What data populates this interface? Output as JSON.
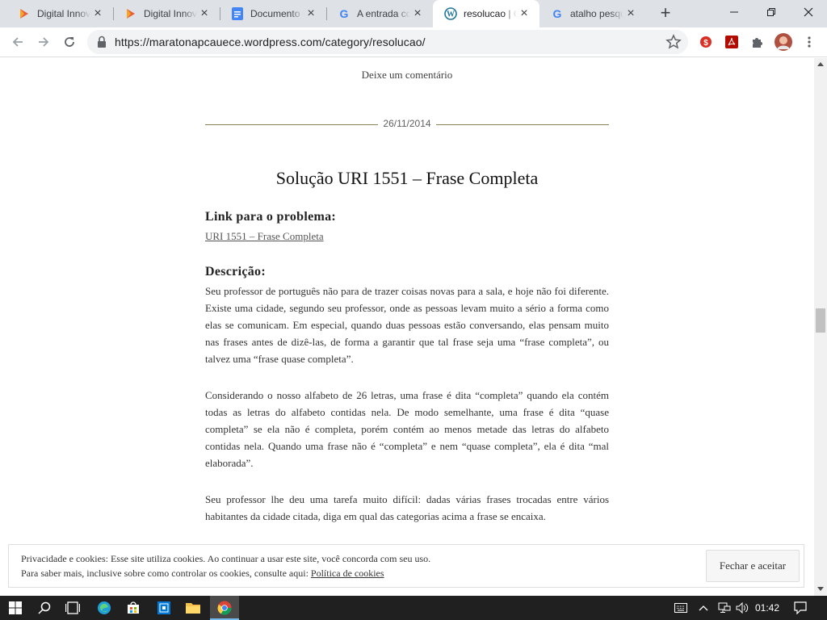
{
  "browser": {
    "tabs": [
      {
        "title": "Digital Innovation One",
        "icon": "dio-icon",
        "active": false
      },
      {
        "title": "Digital Innovation One",
        "icon": "dio-icon",
        "active": false
      },
      {
        "title": "Documento sem título",
        "icon": "google-docs-icon",
        "active": false
      },
      {
        "title": "A entrada co",
        "icon": "google-icon",
        "active": false
      },
      {
        "title": "resolucao | C",
        "icon": "wordpress-icon",
        "active": true
      },
      {
        "title": "atalho pesqu",
        "icon": "google-icon",
        "active": false
      }
    ],
    "url": "https://maratonapcauece.wordpress.com/category/resolucao/"
  },
  "page": {
    "comment_link": "Deixe um comentário",
    "date": "26/11/2014",
    "post_title": "Solução URI 1551 – Frase Completa",
    "link_heading": "Link para o problema:",
    "problem_link": "URI 1551 – Frase Completa",
    "description_heading": "Descrição:",
    "paragraphs": [
      "Seu professor de português não para de trazer coisas novas para a sala, e hoje não foi diferente. Existe uma cidade, segundo seu professor, onde as pessoas levam muito a sério a forma como elas se comunicam. Em especial, quando duas pessoas estão conversando, elas pensam muito nas frases antes de dizê-las, de forma a garantir que tal frase seja uma “frase completa”, ou talvez uma “frase quase completa”.",
      "Considerando o nosso alfabeto de 26 letras, uma frase é dita “completa” quando ela contém todas as letras do alfabeto contidas nela. De modo semelhante, uma frase é dita “quase completa” se ela não é completa, porém contém ao menos metade das letras do alfabeto contidas nela. Quando uma frase não é “completa” e nem “quase completa”, ela é dita “mal elaborada”.",
      "Seu professor lhe deu uma tarefa muito difícil: dadas várias frases trocadas entre vários habitantes da cidade citada, diga em qual das categorias acima a frase se encaixa."
    ]
  },
  "cookie_banner": {
    "line1": "Privacidade e cookies: Esse site utiliza cookies. Ao continuar a usar este site, você concorda com seu uso.",
    "line2_prefix": "Para saber mais, inclusive sobre como controlar os cookies, consulte aqui: ",
    "policy_link": "Política de cookies",
    "accept_button": "Fechar e aceitar"
  },
  "taskbar": {
    "clock": "01:42"
  },
  "colors": {
    "tabstrip_bg": "#dee1e6",
    "date_rule": "#8a7f55",
    "taskbar_bg": "#202020"
  }
}
